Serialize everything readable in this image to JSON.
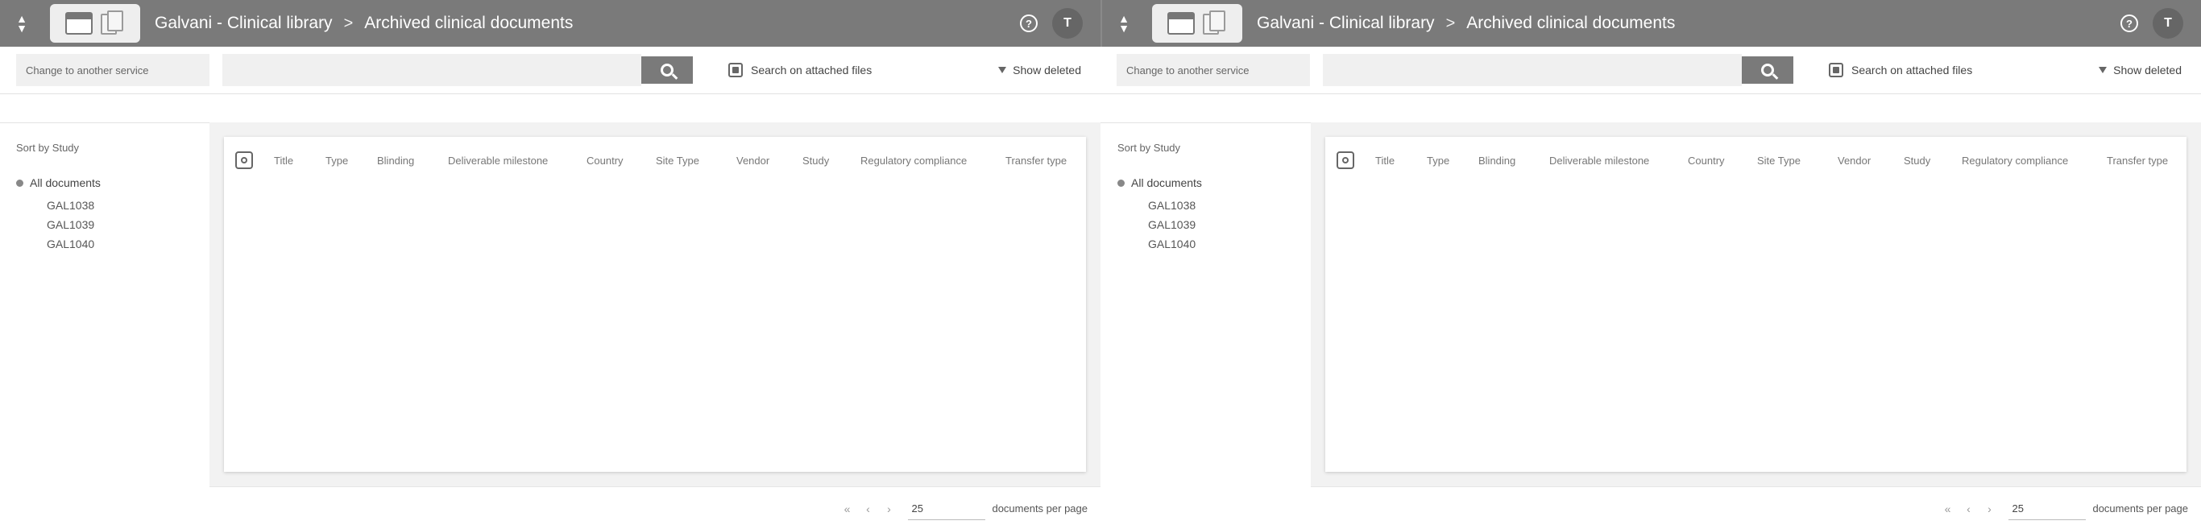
{
  "header": {
    "app_name": "Galvani - Clinical library",
    "section": "Archived clinical documents",
    "separator": ">",
    "avatar_initial": "T",
    "help_glyph": "?"
  },
  "toolbar": {
    "service_placeholder": "Change to another service",
    "search_value": "",
    "attached_label": "Search on attached files",
    "show_deleted_label": "Show deleted"
  },
  "tree": {
    "sort_label": "Sort by Study",
    "root_label": "All documents",
    "items": [
      "GAL1038",
      "GAL1039",
      "GAL1040"
    ]
  },
  "table": {
    "columns": [
      "Title",
      "Type",
      "Blinding",
      "Deliverable milestone",
      "Country",
      "Site Type",
      "Vendor",
      "Study",
      "Regulatory compliance",
      "Transfer type"
    ]
  },
  "pagination": {
    "page_size": "25",
    "per_page_label": "documents per page"
  },
  "colors": {
    "topbar": "#7a7a7a",
    "search_button": "#7a7a7a",
    "panel_bg": "#f2f2f2"
  }
}
